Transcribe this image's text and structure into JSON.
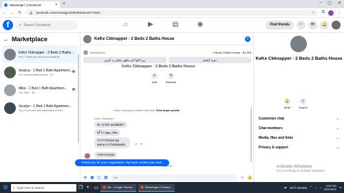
{
  "browser": {
    "tab_title": "Messenger | Facebook",
    "url": "facebook.com/messages/t/8946083146772020"
  },
  "fb": {
    "logo": "f",
    "search_placeholder": "Search Facebook",
    "find_friends": "Find friends"
  },
  "sidebar": {
    "title": "Marketplace",
    "items": [
      {
        "name": "KeKe Ckknapper - 2 Beds 2 Baths...",
        "sub": "You: Thank you for your cooperat..."
      },
      {
        "name": "Jessica - 1 Bed 1 Bath Apartment...",
        "sub": "You sent an attachment · 2d"
      },
      {
        "name": "Mike - 1 Bed 1 Bath Apartmen...",
        "sub": "You sent · 3d"
      },
      {
        "name": "Jocelyn - 1 Bed 1 Bath Apartmen...",
        "sub": "You: If you are still interested to rent..."
      }
    ]
  },
  "chat": {
    "title": "KeKe Ckknapper · 2 Beds 2 Baths House",
    "listing_label": "Marketplace",
    "listing_price": "2 Beds 2 Baths House · $1,000",
    "quick_replies": [
      "زیر التوا کی بطور نشان زد کریں",
      "مزید آپشنز"
    ],
    "faded_title": "KeKe Ckknapper · 2 Beds 2 Baths House",
    "actions": [
      {
        "icon": "+",
        "label": "Add"
      },
      {
        "icon": "✎",
        "label": "Rename"
      }
    ],
    "system_note_prefix": "KeKe Ckknapper started this chat.",
    "system_note_link": "View buyer profile",
    "sender_label": "KeKe Ckknapper",
    "messages": [
      "Hi, is this available?",
      "پیغام بھیج دیا گیا",
      "7777770726 My name is Chrishawda",
      "7797770726"
    ],
    "timestamp": "9:38 PM",
    "outgoing": "Thank you for your cooperation. My team contact you soon.",
    "composer_placeholder": "Aa"
  },
  "right": {
    "name": "KeKe Ckknapper - 2 Beds 2 Baths House",
    "actions": [
      {
        "icon": "🔔",
        "label": "Mute"
      },
      {
        "icon": "⌕",
        "label": "Search"
      }
    ],
    "menu": [
      "Customize chat",
      "Chat members",
      "Media, files and links",
      "Privacy & support"
    ],
    "activate_title": "Activate Windows",
    "activate_sub": "Go to Settings to activate Windows."
  },
  "taskbar": {
    "search_placeholder": "Type here to search",
    "apps": [
      "Me - Google Sheets...",
      "Messenger | Facebo..."
    ],
    "weather": "15°C  Smoke",
    "time": "9:36 PM",
    "date": "5/31/2025"
  }
}
